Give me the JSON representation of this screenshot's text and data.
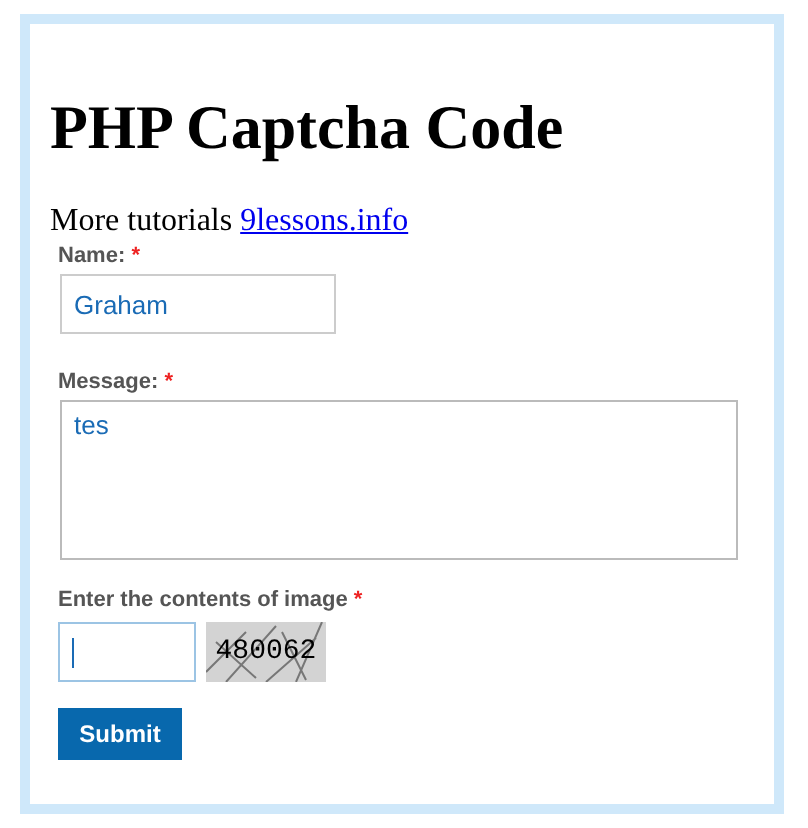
{
  "heading": "PHP Captcha Code",
  "intro": {
    "text": "More tutorials",
    "link": "9lessons.info"
  },
  "fields": [
    {
      "kind": "input",
      "label": "Name:",
      "required_mark": "*",
      "value": "Graham"
    },
    {
      "kind": "textarea",
      "label": "Message:",
      "required_mark": "*",
      "value": "tes"
    }
  ],
  "captcha": {
    "label": "Enter the contents of image",
    "required_mark": "*",
    "code": "480062"
  },
  "submit": "Submit"
}
